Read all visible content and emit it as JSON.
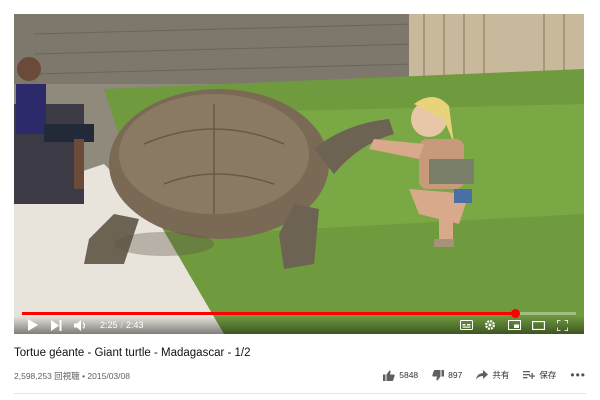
{
  "video": {
    "title": "Tortue géante - Giant turtle - Madagascar - 1/2",
    "views": "2,598,253 回視聴",
    "date": "2015/03/08",
    "separator": "•"
  },
  "player": {
    "current_time": "2:25",
    "duration": "2:43",
    "time_separator": "/",
    "progress": 0.89,
    "accent_color": "#ff0000"
  },
  "controls_icons": [
    "play-icon",
    "next-icon",
    "volume-icon",
    "subtitles-icon",
    "gear-icon",
    "miniplayer-icon",
    "theater-icon",
    "fullscreen-icon"
  ],
  "actions": {
    "like_count": "5848",
    "dislike_count": "897",
    "share_label": "共有",
    "save_label": "保存",
    "more_label": "•••"
  }
}
